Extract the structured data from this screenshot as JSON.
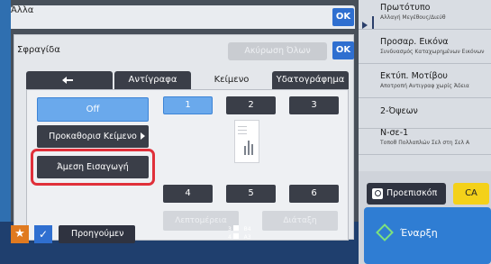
{
  "outer_dialog": {
    "title": "Άλλα",
    "ok_label": "OK"
  },
  "inner_dialog": {
    "title": "Σφραγίδα",
    "ok_label": "OK",
    "cancel_all_label": "Ακύρωση Όλων"
  },
  "tabs": [
    {
      "label": ""
    },
    {
      "label": "Αντίγραφα"
    },
    {
      "label": "Κείμενο"
    },
    {
      "label": "Υδατογράφημα"
    }
  ],
  "left_buttons": {
    "off": "Off",
    "preset_text": "Προκαθορισ Κείμενο",
    "direct_entry": "Άμεση Εισαγωγή"
  },
  "positions": [
    "1",
    "2",
    "3",
    "4",
    "5",
    "6"
  ],
  "disabled_buttons": {
    "details": "Λεπτομέρεια",
    "layout": "Διάταξη"
  },
  "right_panel": [
    {
      "title": "Πρωτότυπο",
      "sub": "Αλλαγή Μεγέθους/Διεύθ"
    },
    {
      "title": "Προσαρ. Εικόνα",
      "sub": "Συνδυασμός Καταχωρημένων Εικόνων"
    },
    {
      "title": "Εκτύπ. Μοτίβου",
      "sub": "Αποτροπή Αντιγραφ χωρίς Άδεια"
    },
    {
      "title": "2-Όψεων",
      "sub": ""
    },
    {
      "title": "N-σε-1",
      "sub": "Τοποθ Πολλαπλών Σελ στη Σελ Α"
    }
  ],
  "preview_label": "Προεπισκόπ",
  "ca_label": "CA",
  "start_label": "Έναρξη",
  "bottom_bar": {
    "previous_label": "Προηγούμεν",
    "paper": [
      {
        "num": "3",
        "size": "B4"
      },
      {
        "num": "4",
        "size": "A3"
      }
    ]
  }
}
